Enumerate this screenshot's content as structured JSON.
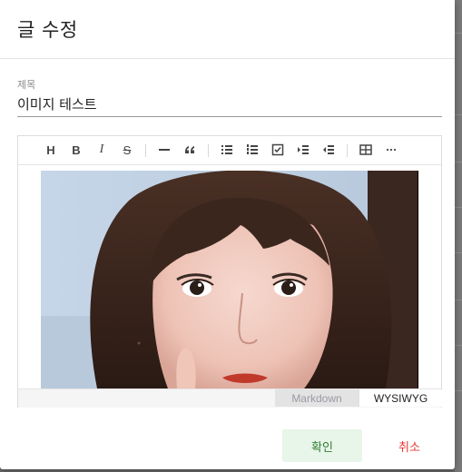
{
  "dialog": {
    "title": "글 수정"
  },
  "title_field": {
    "label": "제목",
    "value": "이미지 테스트"
  },
  "toolbar": {
    "items": [
      {
        "name": "heading",
        "glyph": "H"
      },
      {
        "name": "bold",
        "glyph": "B"
      },
      {
        "name": "italic",
        "glyph": "I"
      },
      {
        "name": "strike",
        "glyph": "S"
      },
      {
        "name": "hr",
        "glyph": "—"
      },
      {
        "name": "quote",
        "glyph": "❝"
      },
      {
        "name": "bullet-list",
        "glyph": "☰"
      },
      {
        "name": "ordered-list",
        "glyph": "1☰"
      },
      {
        "name": "task",
        "glyph": "☑"
      },
      {
        "name": "indent",
        "glyph": "⇥"
      },
      {
        "name": "outdent",
        "glyph": "⇤"
      },
      {
        "name": "table",
        "glyph": "▦"
      },
      {
        "name": "more",
        "glyph": "···"
      }
    ]
  },
  "editor": {
    "modes": {
      "markdown": "Markdown",
      "wysiwyg": "WYSIWYG",
      "active": "WYSIWYG"
    }
  },
  "actions": {
    "confirm_label": "확인",
    "cancel_label": "취소"
  },
  "colors": {
    "confirm_text": "#2e7d32",
    "confirm_bg": "#e8f5e9",
    "cancel_text": "#e53935"
  }
}
